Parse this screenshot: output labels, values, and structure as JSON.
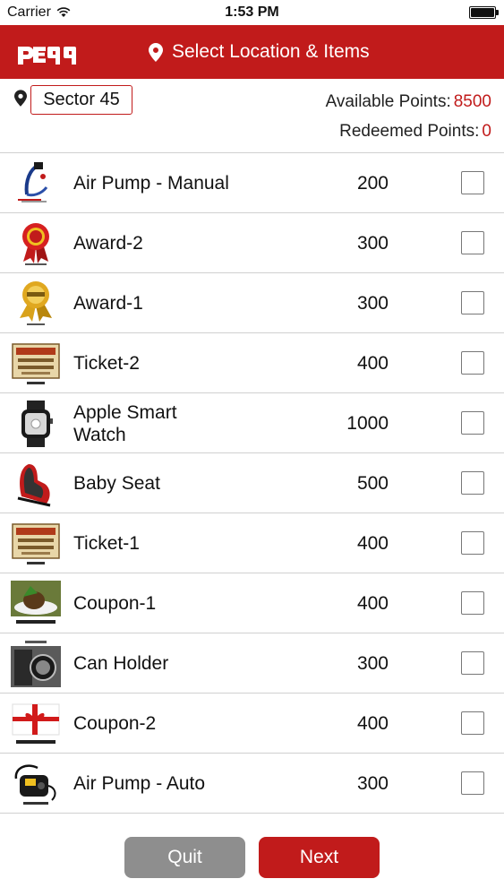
{
  "status_bar": {
    "carrier": "Carrier",
    "time": "1:53 PM"
  },
  "header": {
    "logo_text": "peqq",
    "title": "Select Location & Items"
  },
  "location": {
    "sector": "Sector 45"
  },
  "points": {
    "available_label": "Available Points:",
    "available_value": "8500",
    "redeemed_label": "Redeemed Points:",
    "redeemed_value": "0"
  },
  "items": [
    {
      "name": "Air Pump - Manual",
      "points": "200",
      "icon": "air-pump-manual-image",
      "checked": false
    },
    {
      "name": "Award-2",
      "points": "300",
      "icon": "award-ribbon-red-image",
      "checked": false
    },
    {
      "name": "Award-1",
      "points": "300",
      "icon": "award-ribbon-gold-image",
      "checked": false
    },
    {
      "name": "Ticket-2",
      "points": "400",
      "icon": "cinema-ticket-image",
      "checked": false
    },
    {
      "name": "Apple Smart Watch",
      "points": "1000",
      "icon": "smart-watch-image",
      "checked": false
    },
    {
      "name": "Baby Seat",
      "points": "500",
      "icon": "baby-seat-image",
      "checked": false
    },
    {
      "name": "Ticket-1",
      "points": "400",
      "icon": "cinema-ticket-image",
      "checked": false
    },
    {
      "name": "Coupon-1",
      "points": "400",
      "icon": "dinner-coupon-image",
      "checked": false
    },
    {
      "name": "Can Holder",
      "points": "300",
      "icon": "can-holder-image",
      "checked": false
    },
    {
      "name": "Coupon-2",
      "points": "400",
      "icon": "gift-coupon-image",
      "checked": false
    },
    {
      "name": "Air Pump - Auto",
      "points": "300",
      "icon": "air-pump-auto-image",
      "checked": false
    }
  ],
  "footer": {
    "quit_label": "Quit",
    "next_label": "Next"
  },
  "colors": {
    "brand_red": "#c11b1b",
    "quit_gray": "#8e8e8e"
  }
}
